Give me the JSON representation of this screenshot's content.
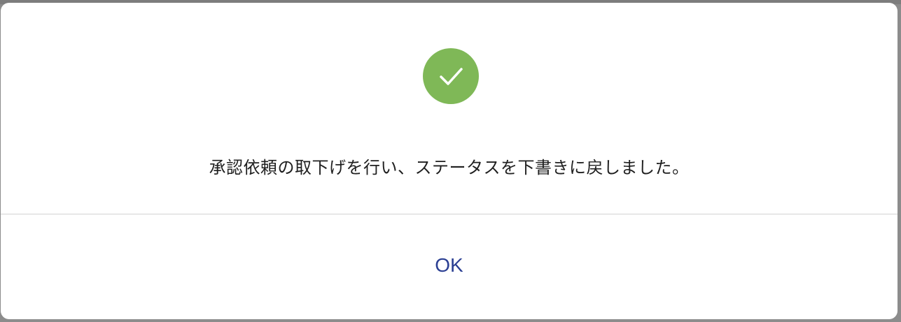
{
  "dialog": {
    "status_icon": "check-circle-icon",
    "status_color": "#7fb857",
    "message": "承認依頼の取下げを行い、ステータスを下書きに戻しました。",
    "ok_label": "OK",
    "ok_color": "#2b3f93"
  }
}
